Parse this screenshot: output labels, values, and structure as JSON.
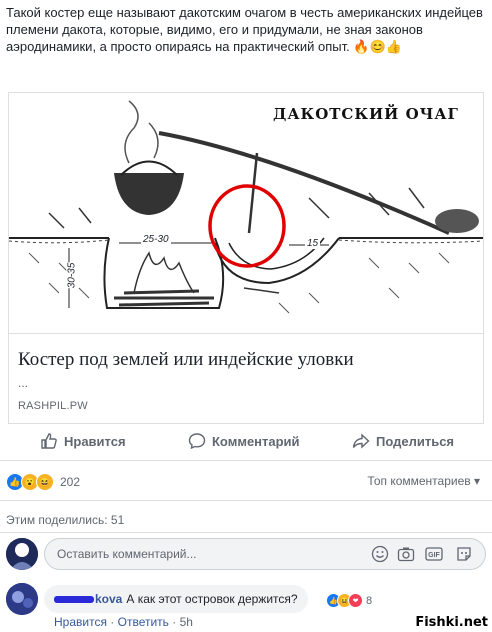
{
  "post": {
    "text": "Такой костер еще называют дакотским очагом в честь американских индейцев племени дакота, которые, видимо, его и придумали, не зная законов аэродинамики, а просто опираясь на практический опыт. 🔥😊👍"
  },
  "link_card": {
    "image_heading": "ДАКОТСКИЙ ОЧАГ",
    "measure_top": "25-30",
    "measure_side": "30-35",
    "measure_tunnel": "15",
    "title": "Костер под землей или индейские уловки",
    "description": "...",
    "source": "RASHPIL.PW"
  },
  "actions": {
    "like": "Нравится",
    "comment": "Комментарий",
    "share": "Поделиться"
  },
  "reactions": {
    "count": "202",
    "sort_label": "Топ комментариев ▾"
  },
  "shares": {
    "text": "Этим поделились: 51"
  },
  "comment_input": {
    "placeholder": "Оставить комментарий..."
  },
  "comment": {
    "author_suffix": "kova",
    "text": "А как этот островок держится?",
    "reactions_count": "8",
    "like": "Нравится",
    "dot": " · ",
    "reply": "Ответить",
    "time": "5h"
  },
  "watermark": "Fishki.net",
  "colors": {
    "link": "#385898",
    "secondary": "#606770",
    "like_blue": "#1877f2",
    "highlight_red": "#e00000"
  }
}
